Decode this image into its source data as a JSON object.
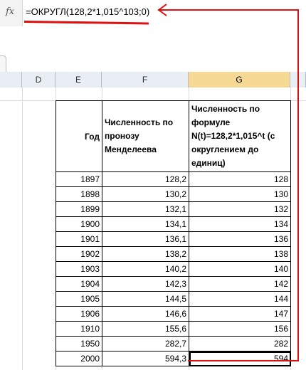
{
  "formula_bar": {
    "fx_label": "fx",
    "formula": "=ОКРУГЛ(128,2*1,015^103;0)"
  },
  "columns": [
    "D",
    "E",
    "F",
    "G"
  ],
  "selected_column": "G",
  "table": {
    "headers": {
      "year": "Год",
      "f": "Численность по пронозу Менделеева",
      "g": "Численность по формуле N(t)=128,2*1,015^t (с округлением до единиц)"
    },
    "rows": [
      {
        "year": "1897",
        "f": "128,2",
        "g": "128"
      },
      {
        "year": "1898",
        "f": "130,2",
        "g": "130"
      },
      {
        "year": "1899",
        "f": "132,1",
        "g": "132"
      },
      {
        "year": "1900",
        "f": "134,1",
        "g": "134"
      },
      {
        "year": "1901",
        "f": "136,1",
        "g": "136"
      },
      {
        "year": "1902",
        "f": "138,2",
        "g": "138"
      },
      {
        "year": "1903",
        "f": "140,2",
        "g": "140"
      },
      {
        "year": "1904",
        "f": "142,3",
        "g": "142"
      },
      {
        "year": "1905",
        "f": "144,5",
        "g": "144"
      },
      {
        "year": "1906",
        "f": "146,6",
        "g": "147"
      },
      {
        "year": "1910",
        "f": "155,6",
        "g": "156"
      },
      {
        "year": "1950",
        "f": "282,7",
        "g": "282"
      },
      {
        "year": "2000",
        "f": "594,3",
        "g": "594"
      }
    ]
  },
  "annotation_color": "#dd1111"
}
